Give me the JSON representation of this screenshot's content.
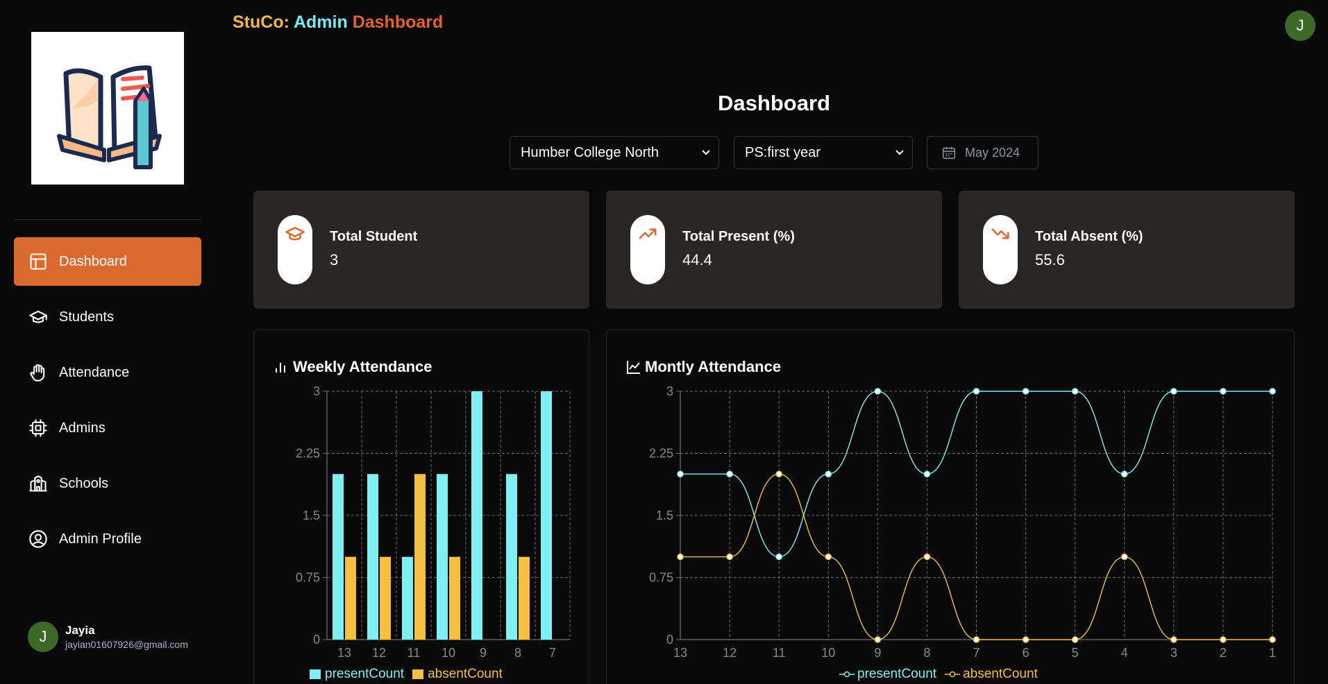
{
  "app": {
    "brand_part1": "StuCo:",
    "brand_part2": "Admin",
    "brand_part3": "Dashboard",
    "avatar_initial": "J"
  },
  "sidebar": {
    "items": [
      {
        "label": "Dashboard",
        "icon": "layout-icon",
        "active": true
      },
      {
        "label": "Students",
        "icon": "graduation-cap-icon",
        "active": false
      },
      {
        "label": "Attendance",
        "icon": "hand-icon",
        "active": false
      },
      {
        "label": "Admins",
        "icon": "cpu-icon",
        "active": false
      },
      {
        "label": "Schools",
        "icon": "school-icon",
        "active": false
      },
      {
        "label": "Admin Profile",
        "icon": "user-circle-icon",
        "active": false
      }
    ],
    "user": {
      "initial": "J",
      "name": "Jayia",
      "email": "jayian01607926@gmail.com"
    }
  },
  "main": {
    "title": "Dashboard",
    "filters": {
      "school": "Humber College North",
      "program": "PS:first year",
      "month": "May 2024"
    },
    "stats": [
      {
        "label": "Total Student",
        "value": "3",
        "icon": "graduation-cap-icon"
      },
      {
        "label": "Total Present (%)",
        "value": "44.4",
        "icon": "trending-up-icon"
      },
      {
        "label": "Total Absent (%)",
        "value": "55.6",
        "icon": "trending-down-icon"
      }
    ]
  },
  "colors": {
    "accent": "#db6a2e",
    "present": "#7ef0f2",
    "absent": "#f5bf3f",
    "card": "#292626"
  },
  "chart_data": [
    {
      "type": "bar",
      "title": "Weekly Attendance",
      "categories": [
        "13",
        "12",
        "11",
        "10",
        "9",
        "8",
        "7"
      ],
      "series": [
        {
          "name": "presentCount",
          "values": [
            2,
            2,
            1,
            2,
            3,
            2,
            3
          ]
        },
        {
          "name": "absentCount",
          "values": [
            1,
            1,
            2,
            1,
            0,
            1,
            0
          ]
        }
      ],
      "yticks": [
        "0",
        "0.75",
        "1.5",
        "2.25",
        "3"
      ],
      "ylim": [
        0,
        3
      ],
      "grid": true,
      "legend": "bottom"
    },
    {
      "type": "line",
      "title": "Montly Attendance",
      "categories": [
        "13",
        "12",
        "11",
        "10",
        "9",
        "8",
        "7",
        "6",
        "5",
        "4",
        "3",
        "2",
        "1"
      ],
      "series": [
        {
          "name": "presentCount",
          "values": [
            2,
            2,
            1,
            2,
            3,
            2,
            3,
            3,
            3,
            2,
            3,
            3,
            3
          ]
        },
        {
          "name": "absentCount",
          "values": [
            1,
            1,
            2,
            1,
            0,
            1,
            0,
            0,
            0,
            1,
            0,
            0,
            0
          ]
        }
      ],
      "yticks": [
        "0",
        "0.75",
        "1.5",
        "2.25",
        "3"
      ],
      "ylim": [
        0,
        3
      ],
      "grid": true,
      "legend": "bottom"
    }
  ]
}
